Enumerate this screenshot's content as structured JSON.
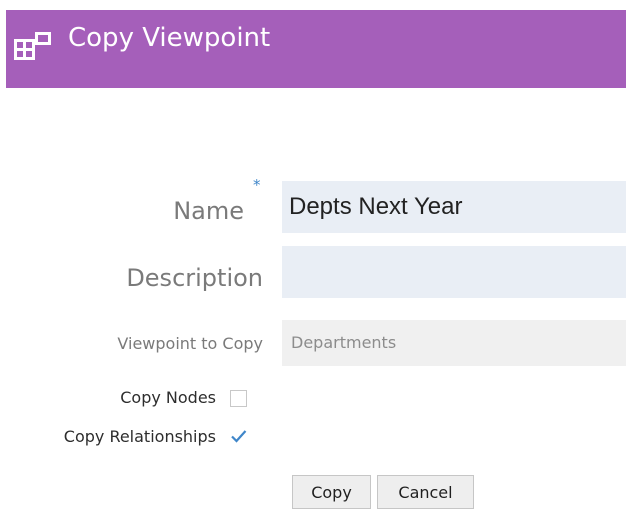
{
  "window": {
    "title": "Copy Viewpoint",
    "icon": "viewpoint-copy-icon",
    "header_color": "#a55fba"
  },
  "form": {
    "name": {
      "label": "Name",
      "required_marker": "*",
      "value": "Depts Next Year"
    },
    "description": {
      "label": "Description",
      "value": ""
    },
    "viewpoint_to_copy": {
      "label": "Viewpoint to Copy",
      "value": "Departments"
    },
    "copy_nodes": {
      "label": "Copy Nodes",
      "checked": false
    },
    "copy_relationships": {
      "label": "Copy Relationships",
      "checked": true
    }
  },
  "actions": {
    "copy_label": "Copy",
    "cancel_label": "Cancel"
  },
  "colors": {
    "accent_check": "#3f86c9",
    "field_background": "#e9eef5",
    "readonly_field_background": "#f0f0f0"
  }
}
